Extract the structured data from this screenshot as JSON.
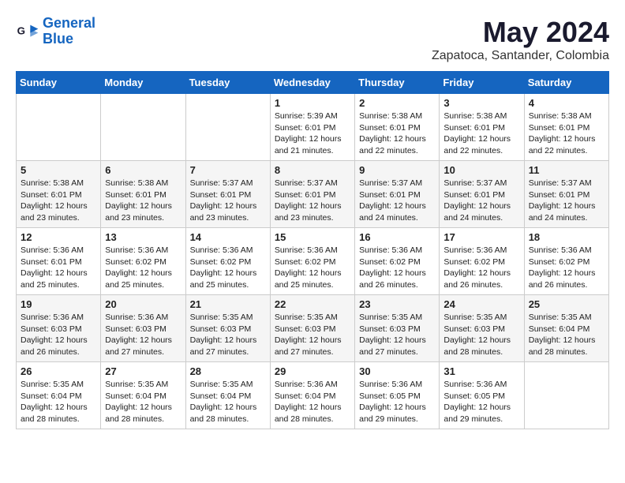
{
  "header": {
    "logo_line1": "General",
    "logo_line2": "Blue",
    "month": "May 2024",
    "location": "Zapatoca, Santander, Colombia"
  },
  "days_of_week": [
    "Sunday",
    "Monday",
    "Tuesday",
    "Wednesday",
    "Thursday",
    "Friday",
    "Saturday"
  ],
  "weeks": [
    [
      {
        "day": "",
        "info": ""
      },
      {
        "day": "",
        "info": ""
      },
      {
        "day": "",
        "info": ""
      },
      {
        "day": "1",
        "info": "Sunrise: 5:39 AM\nSunset: 6:01 PM\nDaylight: 12 hours\nand 21 minutes."
      },
      {
        "day": "2",
        "info": "Sunrise: 5:38 AM\nSunset: 6:01 PM\nDaylight: 12 hours\nand 22 minutes."
      },
      {
        "day": "3",
        "info": "Sunrise: 5:38 AM\nSunset: 6:01 PM\nDaylight: 12 hours\nand 22 minutes."
      },
      {
        "day": "4",
        "info": "Sunrise: 5:38 AM\nSunset: 6:01 PM\nDaylight: 12 hours\nand 22 minutes."
      }
    ],
    [
      {
        "day": "5",
        "info": "Sunrise: 5:38 AM\nSunset: 6:01 PM\nDaylight: 12 hours\nand 23 minutes."
      },
      {
        "day": "6",
        "info": "Sunrise: 5:38 AM\nSunset: 6:01 PM\nDaylight: 12 hours\nand 23 minutes."
      },
      {
        "day": "7",
        "info": "Sunrise: 5:37 AM\nSunset: 6:01 PM\nDaylight: 12 hours\nand 23 minutes."
      },
      {
        "day": "8",
        "info": "Sunrise: 5:37 AM\nSunset: 6:01 PM\nDaylight: 12 hours\nand 23 minutes."
      },
      {
        "day": "9",
        "info": "Sunrise: 5:37 AM\nSunset: 6:01 PM\nDaylight: 12 hours\nand 24 minutes."
      },
      {
        "day": "10",
        "info": "Sunrise: 5:37 AM\nSunset: 6:01 PM\nDaylight: 12 hours\nand 24 minutes."
      },
      {
        "day": "11",
        "info": "Sunrise: 5:37 AM\nSunset: 6:01 PM\nDaylight: 12 hours\nand 24 minutes."
      }
    ],
    [
      {
        "day": "12",
        "info": "Sunrise: 5:36 AM\nSunset: 6:01 PM\nDaylight: 12 hours\nand 25 minutes."
      },
      {
        "day": "13",
        "info": "Sunrise: 5:36 AM\nSunset: 6:02 PM\nDaylight: 12 hours\nand 25 minutes."
      },
      {
        "day": "14",
        "info": "Sunrise: 5:36 AM\nSunset: 6:02 PM\nDaylight: 12 hours\nand 25 minutes."
      },
      {
        "day": "15",
        "info": "Sunrise: 5:36 AM\nSunset: 6:02 PM\nDaylight: 12 hours\nand 25 minutes."
      },
      {
        "day": "16",
        "info": "Sunrise: 5:36 AM\nSunset: 6:02 PM\nDaylight: 12 hours\nand 26 minutes."
      },
      {
        "day": "17",
        "info": "Sunrise: 5:36 AM\nSunset: 6:02 PM\nDaylight: 12 hours\nand 26 minutes."
      },
      {
        "day": "18",
        "info": "Sunrise: 5:36 AM\nSunset: 6:02 PM\nDaylight: 12 hours\nand 26 minutes."
      }
    ],
    [
      {
        "day": "19",
        "info": "Sunrise: 5:36 AM\nSunset: 6:03 PM\nDaylight: 12 hours\nand 26 minutes."
      },
      {
        "day": "20",
        "info": "Sunrise: 5:36 AM\nSunset: 6:03 PM\nDaylight: 12 hours\nand 27 minutes."
      },
      {
        "day": "21",
        "info": "Sunrise: 5:35 AM\nSunset: 6:03 PM\nDaylight: 12 hours\nand 27 minutes."
      },
      {
        "day": "22",
        "info": "Sunrise: 5:35 AM\nSunset: 6:03 PM\nDaylight: 12 hours\nand 27 minutes."
      },
      {
        "day": "23",
        "info": "Sunrise: 5:35 AM\nSunset: 6:03 PM\nDaylight: 12 hours\nand 27 minutes."
      },
      {
        "day": "24",
        "info": "Sunrise: 5:35 AM\nSunset: 6:03 PM\nDaylight: 12 hours\nand 28 minutes."
      },
      {
        "day": "25",
        "info": "Sunrise: 5:35 AM\nSunset: 6:04 PM\nDaylight: 12 hours\nand 28 minutes."
      }
    ],
    [
      {
        "day": "26",
        "info": "Sunrise: 5:35 AM\nSunset: 6:04 PM\nDaylight: 12 hours\nand 28 minutes."
      },
      {
        "day": "27",
        "info": "Sunrise: 5:35 AM\nSunset: 6:04 PM\nDaylight: 12 hours\nand 28 minutes."
      },
      {
        "day": "28",
        "info": "Sunrise: 5:35 AM\nSunset: 6:04 PM\nDaylight: 12 hours\nand 28 minutes."
      },
      {
        "day": "29",
        "info": "Sunrise: 5:36 AM\nSunset: 6:04 PM\nDaylight: 12 hours\nand 28 minutes."
      },
      {
        "day": "30",
        "info": "Sunrise: 5:36 AM\nSunset: 6:05 PM\nDaylight: 12 hours\nand 29 minutes."
      },
      {
        "day": "31",
        "info": "Sunrise: 5:36 AM\nSunset: 6:05 PM\nDaylight: 12 hours\nand 29 minutes."
      },
      {
        "day": "",
        "info": ""
      }
    ]
  ]
}
